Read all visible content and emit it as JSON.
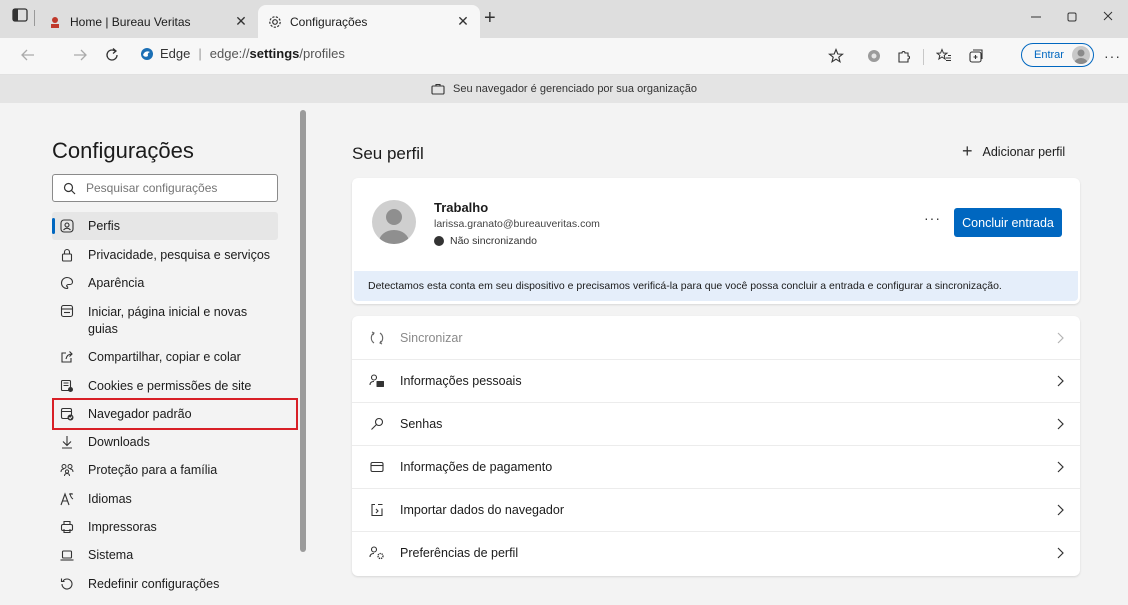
{
  "browser": {
    "tabs": [
      {
        "title": "Home | Bureau Veritas",
        "icon": "bureau-veritas-favicon"
      },
      {
        "title": "Configurações",
        "icon": "gear-icon",
        "active": true
      }
    ],
    "new_tab": "+",
    "address": {
      "brand": "Edge",
      "url_prefix": "edge://",
      "url_bold": "settings",
      "url_suffix": "/profiles"
    },
    "signin_label": "Entrar",
    "more": "···"
  },
  "managed_banner": "Seu navegador é gerenciado por sua organização",
  "sidebar": {
    "title": "Configurações",
    "search_placeholder": "Pesquisar configurações",
    "items": [
      {
        "label": "Perfis",
        "icon": "profile-icon",
        "selected": true
      },
      {
        "label": "Privacidade, pesquisa e serviços",
        "icon": "lock-icon"
      },
      {
        "label": "Aparência",
        "icon": "palette-icon"
      },
      {
        "label": "Iniciar, página inicial e novas guias",
        "icon": "home-icon"
      },
      {
        "label": "Compartilhar, copiar e colar",
        "icon": "share-icon"
      },
      {
        "label": "Cookies e permissões de site",
        "icon": "cookies-icon"
      },
      {
        "label": "Navegador padrão",
        "icon": "browser-icon",
        "highlighted": true
      },
      {
        "label": "Downloads",
        "icon": "download-icon"
      },
      {
        "label": "Proteção para a família",
        "icon": "family-icon"
      },
      {
        "label": "Idiomas",
        "icon": "language-icon"
      },
      {
        "label": "Impressoras",
        "icon": "printer-icon"
      },
      {
        "label": "Sistema",
        "icon": "laptop-icon"
      },
      {
        "label": "Redefinir configurações",
        "icon": "reset-icon"
      }
    ],
    "highlight_color": "#d81f26"
  },
  "main": {
    "title": "Seu perfil",
    "add_profile": "Adicionar perfil",
    "profile": {
      "name": "Trabalho",
      "email": "larissa.granato@bureauveritas.com",
      "sync_status": "Não sincronizando",
      "more": "···",
      "finish_button": "Concluir entrada",
      "notice": "Detectamos esta conta em seu dispositivo e precisamos verificá-la para que você possa concluir a entrada e configurar a sincronização."
    },
    "rows": [
      {
        "label": "Sincronizar",
        "icon": "sync-icon",
        "disabled": true
      },
      {
        "label": "Informações pessoais",
        "icon": "personal-info-icon"
      },
      {
        "label": "Senhas",
        "icon": "key-icon"
      },
      {
        "label": "Informações de pagamento",
        "icon": "credit-card-icon"
      },
      {
        "label": "Importar dados do navegador",
        "icon": "import-icon"
      },
      {
        "label": "Preferências de perfil",
        "icon": "profile-prefs-icon"
      }
    ]
  },
  "colors": {
    "accent": "#0067c0",
    "highlight": "#d81f26",
    "notice_bg": "#e5eefa"
  }
}
